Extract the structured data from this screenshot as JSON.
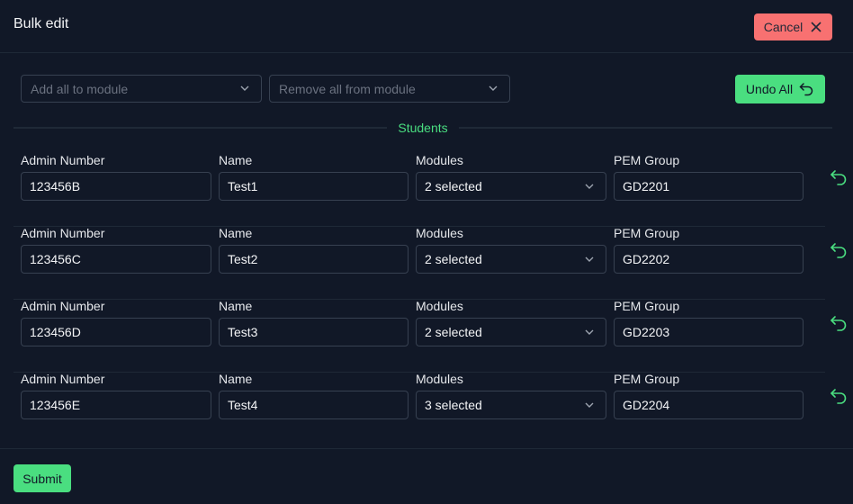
{
  "header": {
    "title": "Bulk edit",
    "cancel_label": "Cancel"
  },
  "toolbar": {
    "add_placeholder": "Add all to module",
    "remove_placeholder": "Remove all from module",
    "undo_all_label": "Undo All"
  },
  "section_label": "Students",
  "labels": {
    "admin": "Admin Number",
    "name": "Name",
    "modules": "Modules",
    "pem": "PEM Group"
  },
  "rows": [
    {
      "admin": "123456B",
      "name": "Test1",
      "modules": "2 selected",
      "pem": "GD2201"
    },
    {
      "admin": "123456C",
      "name": "Test2",
      "modules": "2 selected",
      "pem": "GD2202"
    },
    {
      "admin": "123456D",
      "name": "Test3",
      "modules": "2 selected",
      "pem": "GD2203"
    },
    {
      "admin": "123456E",
      "name": "Test4",
      "modules": "3 selected",
      "pem": "GD2204"
    }
  ],
  "footer": {
    "submit_label": "Submit"
  },
  "colors": {
    "accent": "#4ade80",
    "danger": "#f87171",
    "background": "#111827"
  }
}
